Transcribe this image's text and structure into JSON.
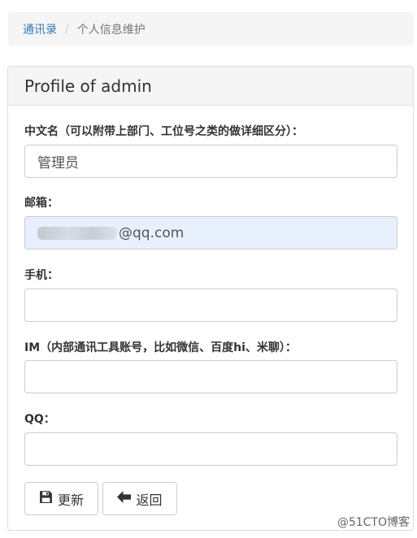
{
  "breadcrumb": {
    "home": "通讯录",
    "separator": "/",
    "current": "个人信息维护"
  },
  "panel": {
    "title": "Profile of admin"
  },
  "form": {
    "chinese_name": {
      "label": "中文名（可以附带上部门、工位号之类的做详细区分）：",
      "value": "管理员"
    },
    "email": {
      "label": "邮箱：",
      "value": "@qq.com"
    },
    "phone": {
      "label": "手机：",
      "value": ""
    },
    "im": {
      "label": "IM（内部通讯工具账号，比如微信、百度hi、米聊）：",
      "value": ""
    },
    "qq": {
      "label": "QQ：",
      "value": ""
    }
  },
  "buttons": {
    "save": "更新",
    "back": "返回"
  },
  "watermark": "@51CTO博客",
  "icons": {
    "save": "floppy-disk-icon",
    "back": "arrow-left-icon"
  }
}
